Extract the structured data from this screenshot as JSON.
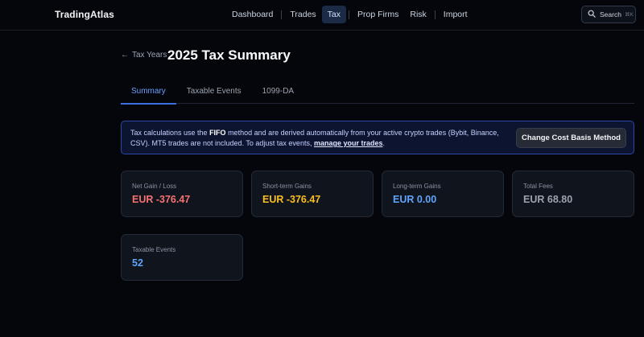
{
  "app": {
    "brand": "TradingAtlas"
  },
  "nav": {
    "items": [
      {
        "label": "Dashboard"
      },
      {
        "label": "Trades"
      },
      {
        "label": "Tax"
      },
      {
        "label": "Prop Firms"
      },
      {
        "label": "Risk"
      },
      {
        "label": "Import"
      }
    ],
    "active": "Tax"
  },
  "search": {
    "label": "Search",
    "shortcut": "⌘K"
  },
  "header": {
    "back_label": "Tax Years",
    "title": "2025 Tax Summary"
  },
  "tabs": [
    {
      "label": "Summary"
    },
    {
      "label": "Taxable Events"
    },
    {
      "label": "1099-DA"
    }
  ],
  "banner": {
    "text_pre": "Tax calculations use the ",
    "method": "FIFO",
    "text_mid": " method and are derived automatically from your active crypto trades (Bybit, Binance, CSV). MT5 trades are not included. To adjust tax events, ",
    "link": "manage your trades",
    "text_post": ".",
    "button": "Change Cost Basis Method"
  },
  "cards": [
    {
      "label": "Net Gain / Loss",
      "value": "EUR -376.47",
      "color": "#f87171"
    },
    {
      "label": "Short-term Gains",
      "value": "EUR -376.47",
      "color": "#fbbf24"
    },
    {
      "label": "Long-term Gains",
      "value": "EUR 0.00",
      "color": "#60a5fa"
    },
    {
      "label": "Total Fees",
      "value": "EUR 68.80",
      "color": "#9ca3af"
    },
    {
      "label": "Taxable Events",
      "value": "52",
      "color": "#60a5fa"
    }
  ],
  "colors": {
    "accent": "#3b6fe0",
    "background": "#05060c"
  }
}
